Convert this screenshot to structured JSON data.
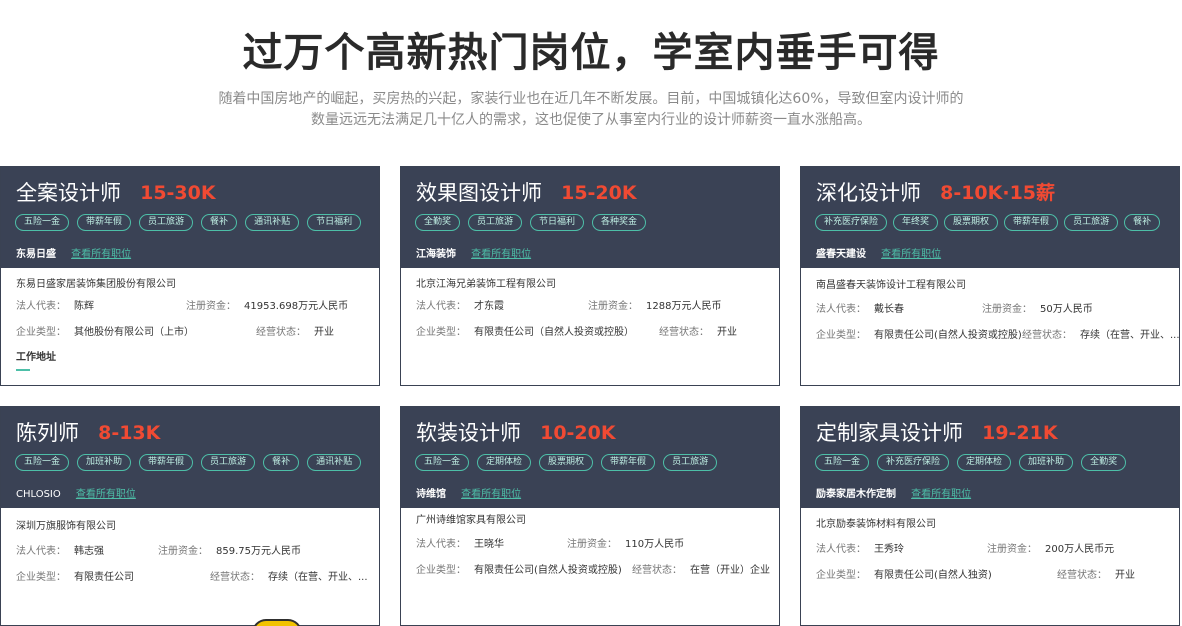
{
  "hero": {
    "title": "过万个高新热门岗位，学室内垂手可得",
    "desc_line1": "随着中国房地产的崛起，买房热的兴起，家装行业也在近几年不断发展。目前，中国城镇化达60%，导致但室内设计师的",
    "desc_line2": "数量远远无法满足几十亿人的需求，这也促使了从事室内行业的设计师薪资一直水涨船高。"
  },
  "labels": {
    "view_all": "查看所有职位",
    "legal_rep": "法人代表：",
    "reg_capital": "注册资金：",
    "company_type": "企业类型：",
    "status": "经营状态：",
    "work_address": "工作地址"
  },
  "cards": [
    {
      "title": "全案设计师",
      "salary": "15-30K",
      "tags": [
        "五险一金",
        "带薪年假",
        "员工旅游",
        "餐补",
        "通讯补贴",
        "节日福利"
      ],
      "brand": "东易日盛",
      "company": "东易日盛家居装饰集团股份有限公司",
      "legal_rep": "陈辉",
      "capital": "41953.698万元人民币",
      "type": "其他股份有限公司（上市）",
      "status": "开业"
    },
    {
      "title": "效果图设计师",
      "salary": "15-20K",
      "tags": [
        "全勤奖",
        "员工旅游",
        "节日福利",
        "各种奖金"
      ],
      "brand": "江海装饰",
      "company": "北京江海兄弟装饰工程有限公司",
      "legal_rep": "才东霞",
      "capital": "1288万元人民币",
      "type": "有限责任公司（自然人投资或控股）",
      "status": "开业"
    },
    {
      "title": "深化设计师",
      "salary": "8-10K·15薪",
      "tags": [
        "补充医疗保险",
        "年终奖",
        "股票期权",
        "带薪年假",
        "员工旅游",
        "餐补"
      ],
      "brand": "盛春天建设",
      "company": "南昌盛春天装饰设计工程有限公司",
      "legal_rep": "戴长春",
      "capital": "50万人民币",
      "type": "有限责任公司(自然人投资或控股)",
      "status": "存续（在营、开业、..."
    },
    {
      "title": "陈列师",
      "salary": "8-13K",
      "tags": [
        "五险一金",
        "加班补助",
        "带薪年假",
        "员工旅游",
        "餐补",
        "通讯补贴"
      ],
      "brand": "CHLOSIO",
      "company": "深圳万旗服饰有限公司",
      "legal_rep": "韩志强",
      "capital": "859.75万元人民币",
      "type": "有限责任公司",
      "status": "存续（在营、开业、..."
    },
    {
      "title": "软装设计师",
      "salary": "10-20K",
      "tags": [
        "五险一金",
        "定期体检",
        "股票期权",
        "带薪年假",
        "员工旅游"
      ],
      "brand": "诗维馆",
      "company": "广州诗维馆家具有限公司",
      "legal_rep": "王晓华",
      "capital": "110万人民币",
      "type": "有限责任公司(自然人投资或控股)",
      "status": "在营（开业）企业"
    },
    {
      "title": "定制家具设计师",
      "salary": "19-21K",
      "tags": [
        "五险一金",
        "补充医疗保险",
        "定期体检",
        "加班补助",
        "全勤奖"
      ],
      "brand": "励泰家居木作定制",
      "company": "北京励泰装饰材料有限公司",
      "legal_rep": "王秀玲",
      "capital": "200万人民币元",
      "type": "有限责任公司(自然人独资)",
      "status": "开业"
    }
  ]
}
